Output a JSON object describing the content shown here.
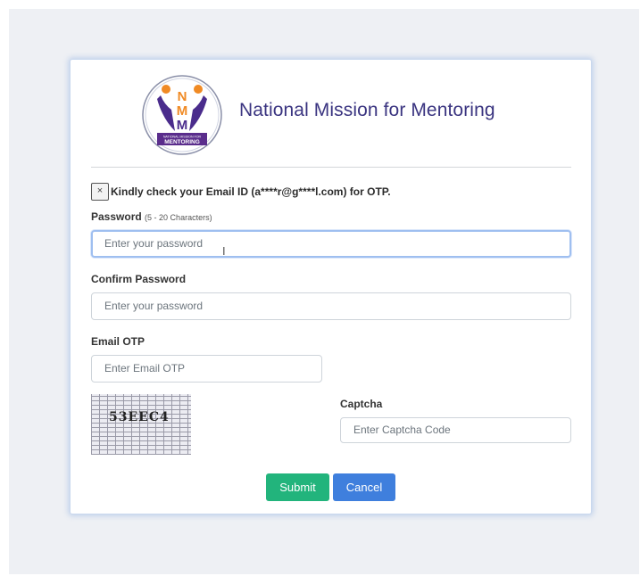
{
  "brand": {
    "title": "National Mission for Mentoring",
    "logo_letters": [
      "N",
      "M",
      "M"
    ],
    "logo_banner_small": "NATIONAL MISSION FOR",
    "logo_banner": "MENTORING"
  },
  "alert": {
    "close_glyph": "×",
    "message": "Kindly check your Email ID (a****r@g****l.com) for OTP."
  },
  "form": {
    "password": {
      "label": "Password",
      "hint": "(5 - 20 Characters)",
      "placeholder": "Enter your password"
    },
    "confirm_password": {
      "label": "Confirm Password",
      "placeholder": "Enter your password"
    },
    "email_otp": {
      "label": "Email OTP",
      "placeholder": "Enter Email OTP"
    },
    "captcha": {
      "image_text": "53EEC4",
      "label": "Captcha",
      "placeholder": "Enter Captcha Code"
    }
  },
  "buttons": {
    "submit": "Submit",
    "cancel": "Cancel"
  },
  "colors": {
    "brand_title": "#3a3480",
    "submit": "#22b47c",
    "cancel": "#3f7fdd",
    "focus_border": "#9fbff0"
  }
}
